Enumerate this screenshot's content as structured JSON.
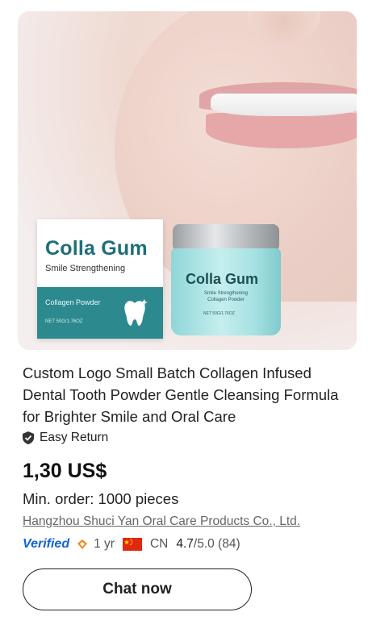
{
  "product": {
    "image_alt": "Colla Gum collagen tooth powder product photo",
    "box": {
      "brand": "Colla Gum",
      "subtitle": "Smile Strengthening",
      "variant": "Collagen Powder",
      "net": "NET 50G/1.76OZ"
    },
    "jar": {
      "brand": "Colla Gum",
      "subtitle": "Smile Strengthening\nCollagen Powder",
      "net": "NET 50G/1.76OZ"
    },
    "title": "Custom Logo Small Batch Collagen Infused Dental Tooth Powder Gentle Cleansing Formula for Brighter Smile and Oral Care",
    "easy_return": "Easy Return",
    "price": "1,30 US$",
    "min_order": "Min. order: 1000 pieces"
  },
  "supplier": {
    "name": "Hangzhou Shuci Yan Oral Care Products Co., Ltd.",
    "verified_label": "Verified",
    "years": "1 yr",
    "country": "CN",
    "rating_score": "4.7",
    "rating_rest": "/5.0 (84)"
  },
  "actions": {
    "chat_label": "Chat now"
  },
  "colors": {
    "brand_teal": "#2c8a8f",
    "verified_blue": "#1662d6",
    "accent_orange": "#f08a1c"
  },
  "icons": {
    "shield": "shield-check-icon",
    "diamond": "diamond-icon",
    "flag": "china-flag-icon"
  }
}
